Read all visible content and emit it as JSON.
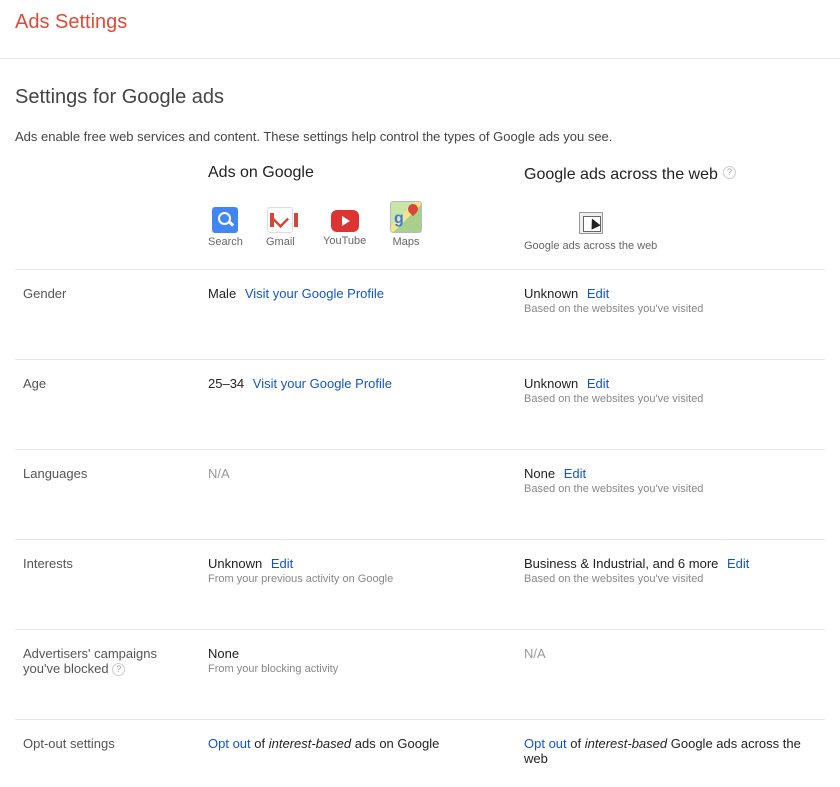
{
  "header": {
    "title": "Ads Settings"
  },
  "page": {
    "title": "Settings for Google ads",
    "intro": "Ads enable free web services and content. These settings help control the types of Google ads you see."
  },
  "columns": {
    "google": {
      "title": "Ads on Google",
      "apps": [
        {
          "label": "Search",
          "icon": "search-icon"
        },
        {
          "label": "Gmail",
          "icon": "gmail-icon"
        },
        {
          "label": "YouTube",
          "icon": "youtube-icon"
        },
        {
          "label": "Maps",
          "icon": "maps-icon"
        }
      ]
    },
    "web": {
      "title": "Google ads across the web",
      "help": "?",
      "image_caption": "Google ads across the web"
    }
  },
  "rows": {
    "gender": {
      "label": "Gender",
      "google_value": "Male",
      "google_link": "Visit your Google Profile",
      "web_value": "Unknown",
      "web_link": "Edit",
      "web_sub": "Based on the websites you've visited"
    },
    "age": {
      "label": "Age",
      "google_value": "25–34",
      "google_link": "Visit your Google Profile",
      "web_value": "Unknown",
      "web_link": "Edit",
      "web_sub": "Based on the websites you've visited"
    },
    "languages": {
      "label": "Languages",
      "google_value": "N/A",
      "web_value": "None",
      "web_link": "Edit",
      "web_sub": "Based on the websites you've visited"
    },
    "interests": {
      "label": "Interests",
      "google_value": "Unknown",
      "google_link": "Edit",
      "google_sub": "From your previous activity on Google",
      "web_value": "Business & Industrial, and 6 more",
      "web_link": "Edit",
      "web_sub": "Based on the websites you've visited"
    },
    "blocked": {
      "label_line1": "Advertisers' campaigns",
      "label_line2": "you've blocked",
      "help": "?",
      "google_value": "None",
      "google_sub": "From your blocking activity",
      "web_value": "N/A"
    },
    "optout": {
      "label": "Opt-out settings",
      "google_link": "Opt out",
      "google_of": "of",
      "google_em": "interest-based",
      "google_rest": "ads on Google",
      "web_link": "Opt out",
      "web_of": "of",
      "web_em": "interest-based",
      "web_rest": "Google ads across the web"
    }
  },
  "colors": {
    "title": "#dd4b39",
    "link": "#1155cc",
    "muted": "#888888"
  }
}
